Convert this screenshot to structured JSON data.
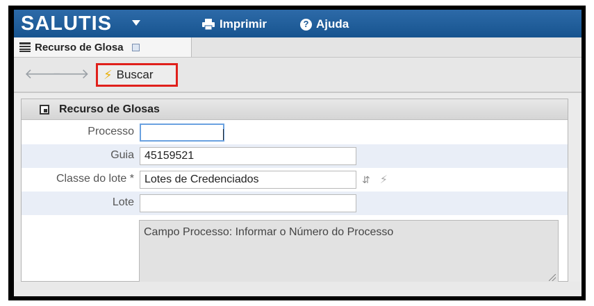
{
  "app": {
    "brand": "SALUTIS",
    "print_label": "Imprimir",
    "help_label": "Ajuda"
  },
  "tabs": [
    {
      "label": "Recurso de Glosa",
      "active": true
    }
  ],
  "toolbar": {
    "search_label": "Buscar",
    "search_icon": "lightning-icon"
  },
  "panel": {
    "title": "Recurso de Glosas",
    "fields": {
      "processo": {
        "label": "Processo",
        "value": ""
      },
      "guia": {
        "label": "Guia",
        "value": "45159521"
      },
      "classe": {
        "label": "Classe do lote *",
        "value": "Lotes de Credenciados"
      },
      "lote": {
        "label": "Lote",
        "value": ""
      }
    },
    "note": "Campo Processo: Informar o Número do Processo"
  },
  "colors": {
    "topbar": "#1f5e9c",
    "highlight": "#e0201b",
    "shaded_row": "#e9eef7"
  }
}
